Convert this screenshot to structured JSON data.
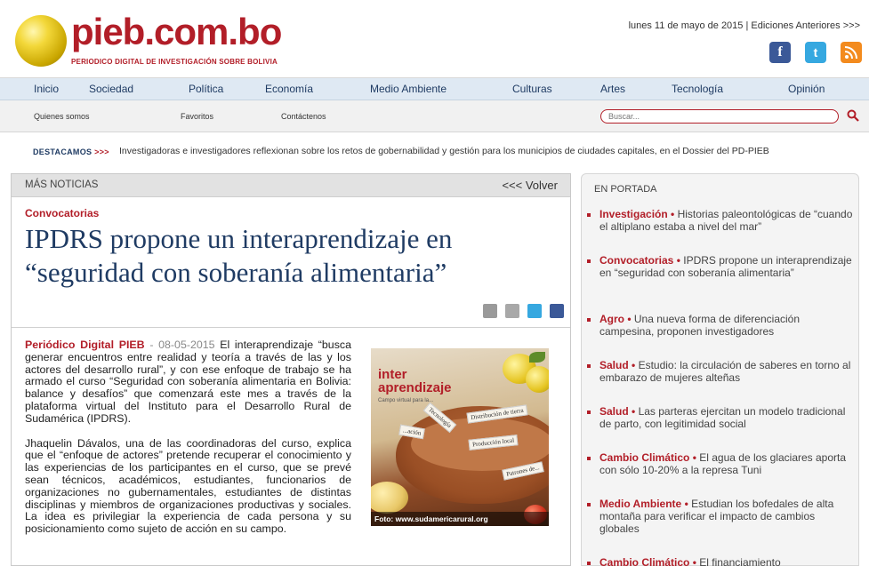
{
  "header": {
    "logo_name": "pieb",
    "logo_domain": ".com.bo",
    "logo_tagline": "PERIODICO DIGITAL DE INVESTIGACIÓN SOBRE BOLIVIA",
    "date_text": "lunes 11 de mayo de 2015 | Ediciones Anteriores >>>",
    "social": [
      "facebook-icon",
      "twitter-icon",
      "rss-icon"
    ]
  },
  "main_nav": [
    "Inicio",
    "Sociedad",
    "Política",
    "Economía",
    "Medio Ambiente",
    "Culturas",
    "Artes",
    "Tecnología",
    "Opinión"
  ],
  "sub_nav": [
    "Quienes somos",
    "Favoritos",
    "Contáctenos"
  ],
  "search": {
    "placeholder": "Buscar..."
  },
  "destacamos": {
    "label": "DESTACAMOS",
    "arrows": ">>>",
    "text": "Investigadoras e investigadores reflexionan sobre los retos de gobernabilidad y gestión para los municipios de ciudades capitales, en el Dossier del PD-PIEB"
  },
  "article": {
    "bar_left": "MÁS NOTICIAS",
    "bar_right": "<<< Volver",
    "section": "Convocatorias",
    "title": "IPDRS propone un interaprendizaje en “seguridad con soberanía alimentaria”",
    "byline": "Periódico Digital PIEB",
    "date": "- 08-05-2015",
    "paragraph1": " El interaprendizaje “busca generar encuentros entre realidad y teoría a través de las y los actores del desarrollo rural”, y con ese enfoque de trabajo se ha armado el curso “Seguridad con soberanía alimentaria en Bolivia: balance y desafíos” que comenzará este mes a través de la plataforma virtual del Instituto para el Desarrollo Rural de Sudamérica (IPDRS).",
    "paragraph2": "Jhaquelin Dávalos, una de las coordinadoras del curso, explica que el “enfoque de actores” pretende recuperar el conocimiento y las experiencias de los participantes en el curso, que se prevé sean técnicos, académicos, estudiantes, funcionarios de organizaciones no gubernamentales, estudiantes de distintas disciplinas y miembros de organizaciones productivas y sociales. La idea es privilegiar la experiencia de cada persona y su posicionamiento como sujeto de acción en su campo.",
    "photo_caption": "Foto: www.sudamericarural.org",
    "photo_logo_top": "inter",
    "photo_logo_bottom": "aprendizaje",
    "photo_logo_small": "Campo virtual para la...",
    "photo_papers": [
      "Distribución de tierra",
      "Tecnología",
      "Producción local",
      "Patrones de...",
      "...ación"
    ]
  },
  "sidebar": {
    "title": "EN PORTADA",
    "items": [
      {
        "cat": "Investigación",
        "text": "Historias paleontológicas de “cuando el altiplano estaba a nivel del mar”"
      },
      {
        "cat": "Convocatorias",
        "text": "IPDRS propone un interaprendizaje en “seguridad con soberanía alimentaria”"
      },
      {
        "cat": "Agro",
        "text": "Una nueva forma de diferenciación campesina, proponen investigadores"
      },
      {
        "cat": "Salud",
        "text": "Estudio: la circulación de saberes en torno al embarazo de mujeres alteñas"
      },
      {
        "cat": "Salud",
        "text": "Las parteras ejercitan un modelo tradicional de parto, con legitimidad social"
      },
      {
        "cat": "Cambio Climático",
        "text": "El agua de los glaciares aporta con sólo 10-20% a la represa Tuni"
      },
      {
        "cat": "Medio Ambiente",
        "text": "Estudian los bofedales de alta montaña para verificar el impacto de cambios globales"
      },
      {
        "cat": "Cambio Climático",
        "text": "El financiamiento"
      }
    ]
  },
  "colors": {
    "brand_red": "#b21e28",
    "nav_blue": "#1f3b63",
    "nav_bg": "#dfe9f3"
  }
}
